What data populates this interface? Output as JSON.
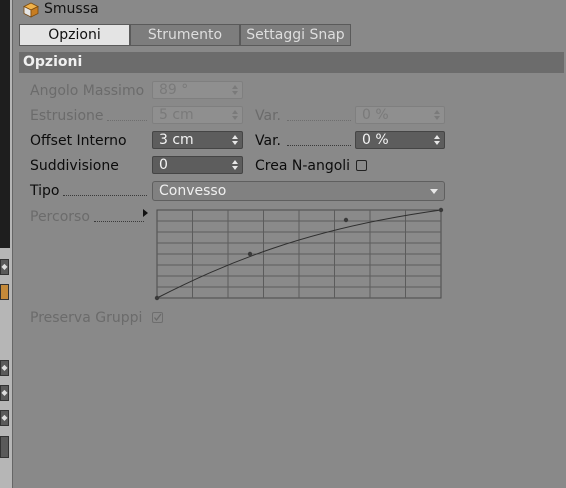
{
  "window": {
    "title": "Smussa"
  },
  "tabs": [
    {
      "label": "Opzioni",
      "active": true
    },
    {
      "label": "Strumento",
      "active": false
    },
    {
      "label": "Settaggi Snap",
      "active": false
    }
  ],
  "section": {
    "title": "Opzioni"
  },
  "fields": {
    "angolo_massimo": {
      "label": "Angolo Massimo",
      "value": "89 °",
      "enabled": false
    },
    "estrusione": {
      "label": "Estrusione",
      "value": "5 cm",
      "enabled": false
    },
    "estrusione_var": {
      "label": "Var.",
      "value": "0 %",
      "enabled": false
    },
    "offset_interno": {
      "label": "Offset Interno",
      "value": "3 cm",
      "enabled": true
    },
    "offset_var": {
      "label": "Var.",
      "value": "0 %",
      "enabled": true
    },
    "suddivisione": {
      "label": "Suddivisione",
      "value": "0",
      "enabled": true
    },
    "crea_n_angoli": {
      "label": "Crea N-angoli",
      "checked": false
    },
    "tipo": {
      "label": "Tipo",
      "value": "Convesso"
    },
    "percorso": {
      "label": "Percorso",
      "enabled": false
    },
    "preserva_gruppi": {
      "label": "Preserva Gruppi",
      "checked": true,
      "enabled": false
    }
  },
  "colors": {
    "panel_bg": "#898989",
    "section_bar": "#6c6c6c",
    "active_tab": "#e4e4e4"
  },
  "icons": {
    "title": "cube-icon",
    "spin": "spinner-arrows-icon",
    "dropdown": "chevron-down-icon"
  }
}
